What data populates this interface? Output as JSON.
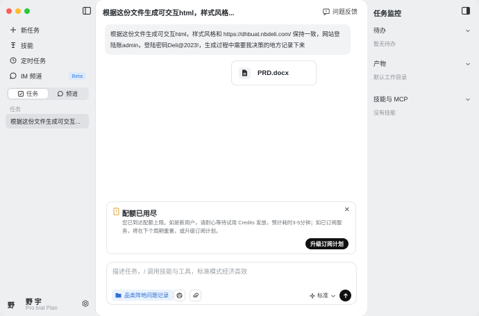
{
  "sidebar": {
    "nav": [
      {
        "label": "新任务",
        "icon": "plus-icon"
      },
      {
        "label": "技能",
        "icon": "skill-icon"
      },
      {
        "label": "定时任务",
        "icon": "clock-icon"
      },
      {
        "label": "IM 频道",
        "icon": "chat-icon",
        "badge": "Beta"
      }
    ],
    "segment": {
      "tasks": "任务",
      "channels": "频道",
      "active": "任务"
    },
    "section_label": "任务",
    "task_items": [
      "根据这份文件生成可交互..."
    ],
    "user": {
      "avatar": "野",
      "name": "野 宇",
      "plan": "Pro trial Plan"
    }
  },
  "main": {
    "title": "根据这份文件生成可交互html，样式风格...",
    "feedback": "问题反馈",
    "user_message": "根据这份文件生成可交互html，样式风格和 https://dhbuat.nbdeli.com/ 保持一致，网站登陆账admin，登陆密码Deli@2023!，生成过程中需要我决策的地方记录下来",
    "attachment": "PRD.docx",
    "quota": {
      "title": "配额已用尽",
      "text": "您已到达配额上限。如是新用户，请耐心等待试用 Credits 发放，预计耗时3-5分钟；如已订阅服务，将在下个周期重置，或升级订阅计划。",
      "button": "升级订阅计划"
    },
    "composer": {
      "placeholder": "描述任务，/ 调用技能与工具，标准模式经济高效",
      "tag": "品类阵地问题记录",
      "mode": "标准"
    }
  },
  "right_panel": {
    "title": "任务监控",
    "sections": [
      {
        "title": "待办",
        "sub": "暂无待办"
      },
      {
        "title": "产物",
        "sub": "默认工作目录"
      },
      {
        "title": "技能与 MCP",
        "sub": "没有技能"
      }
    ]
  },
  "colors": {
    "accent_blue": "#2f6fd6",
    "badge_bg": "#dce9fb",
    "button_dark": "#111111",
    "warning": "#e0a030"
  }
}
